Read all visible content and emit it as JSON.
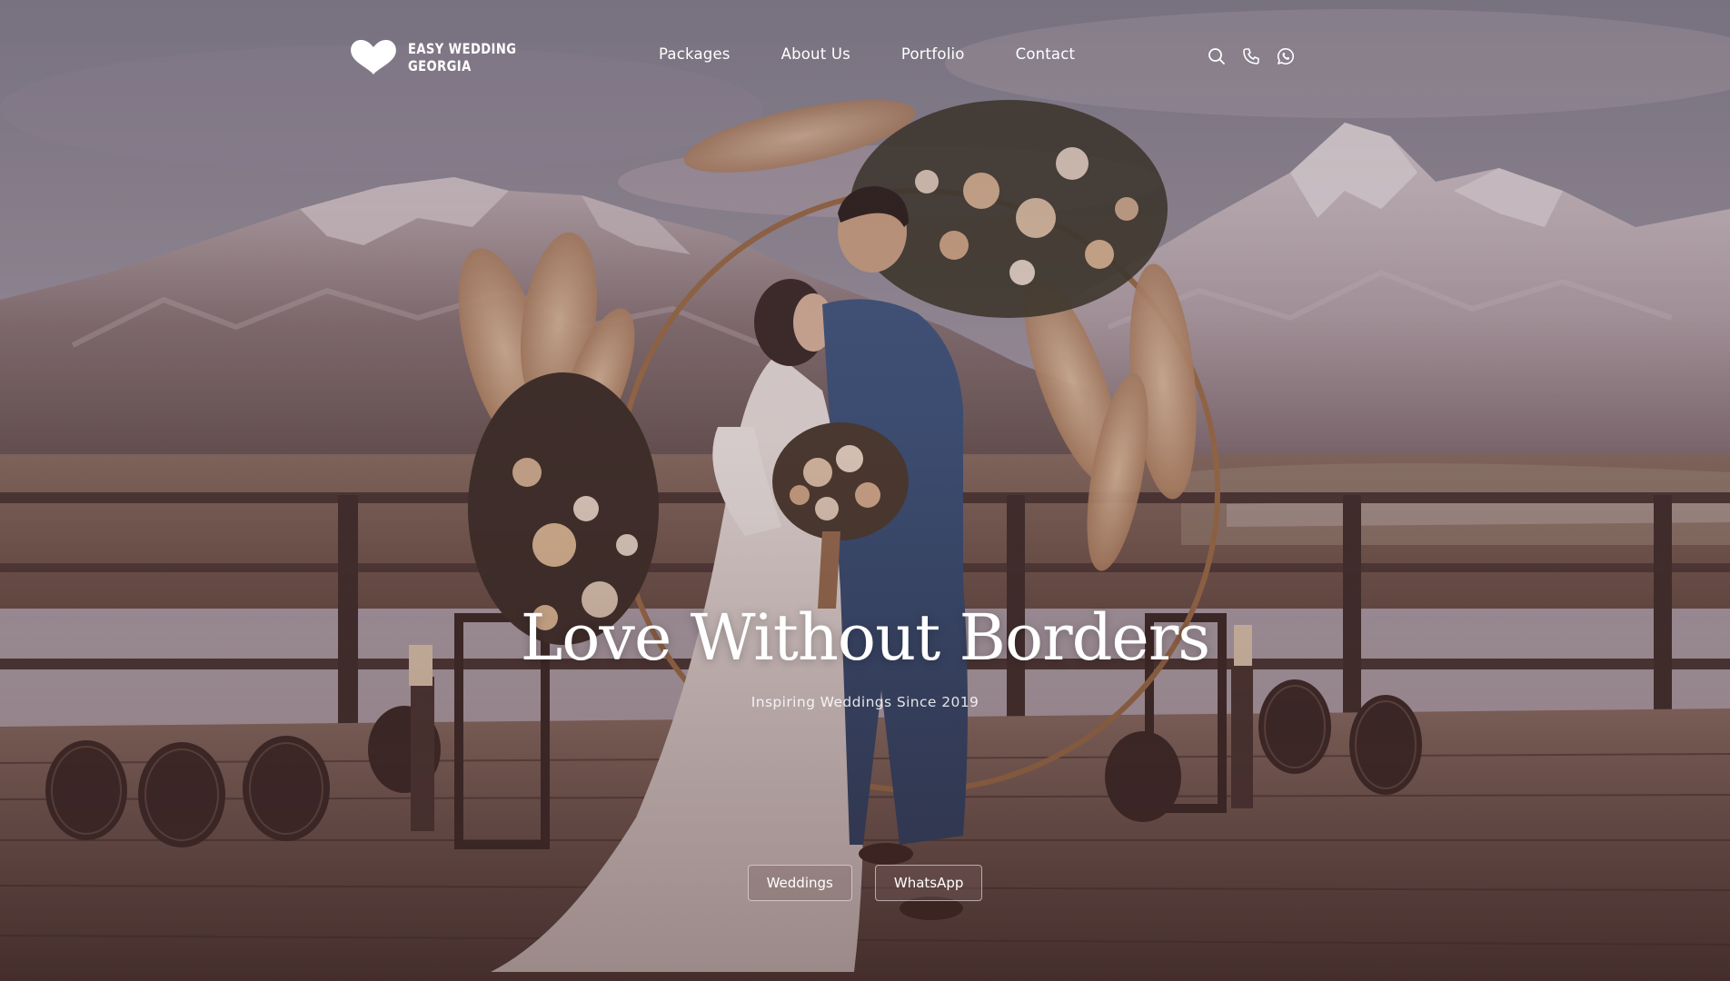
{
  "brand": {
    "logo_icon": "heart-icon",
    "name_line1": "Easy Wedding",
    "name_line2": "Georgia"
  },
  "nav": {
    "items": [
      {
        "label": "Packages"
      },
      {
        "label": "About Us"
      },
      {
        "label": "Portfolio"
      },
      {
        "label": "Contact"
      }
    ],
    "icons": [
      "search-icon",
      "phone-icon",
      "whatsapp-icon"
    ]
  },
  "hero": {
    "title": "Love Without Borders",
    "subtitle": "Inspiring Weddings Since 2019",
    "buttons": [
      {
        "label": "Weddings"
      },
      {
        "label": "WhatsApp"
      }
    ],
    "background_image": "couple-at-floral-arch-mountain-terrace"
  },
  "colors": {
    "text": "#ffffff",
    "overlay": "#5a3a40"
  }
}
